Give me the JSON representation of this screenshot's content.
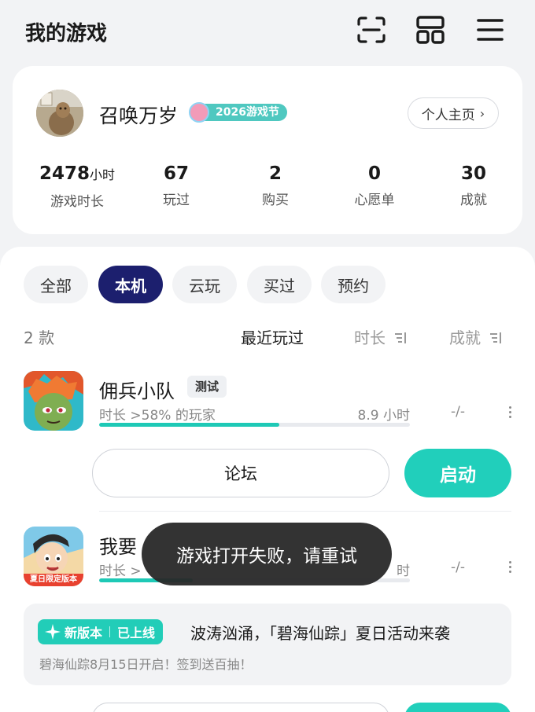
{
  "header": {
    "title": "我的游戏",
    "icons": [
      "scan-icon",
      "grid-icon",
      "menu-icon"
    ]
  },
  "profile": {
    "username": "召唤万岁",
    "badge_text": "2026游戏节",
    "homepage_label": "个人主页",
    "homepage_chevron": "›",
    "stats": [
      {
        "value": "2478",
        "unit": "小时",
        "label": "游戏时长"
      },
      {
        "value": "67",
        "unit": "",
        "label": "玩过"
      },
      {
        "value": "2",
        "unit": "",
        "label": "购买"
      },
      {
        "value": "0",
        "unit": "",
        "label": "心愿单"
      },
      {
        "value": "30",
        "unit": "",
        "label": "成就"
      }
    ]
  },
  "filters": {
    "chips": [
      "全部",
      "本机",
      "云玩",
      "买过",
      "预约"
    ],
    "active_index": 1
  },
  "list": {
    "count": "2 款",
    "sort_recent": "最近玩过",
    "sort_duration": "时长",
    "sort_achievement": "成就"
  },
  "games": [
    {
      "name": "佣兵小队",
      "tag": "测试",
      "subtitle": "时长 >58% 的玩家",
      "hours": "8.9 小时",
      "achievements": "-/-",
      "progress_percent": 58,
      "forum_label": "论坛",
      "launch_label": "启动"
    },
    {
      "name": "我要",
      "subtitle": "时长 >",
      "hours": "时",
      "achievements": "-/-",
      "icon_caption": "夏日限定版本",
      "progress_percent": 30
    }
  ],
  "promo": {
    "tag_new": "新版本",
    "tag_online": "已上线",
    "title": "波涛汹涌，「碧海仙踪」夏日活动来袭",
    "subtitle": "碧海仙踪8月15日开启！签到送百抽！"
  },
  "toast": {
    "message": "游戏打开失败，请重试"
  },
  "colors": {
    "accent": "#21cfbb",
    "active_chip": "#1c1f6e",
    "background": "#f2f3f5"
  }
}
